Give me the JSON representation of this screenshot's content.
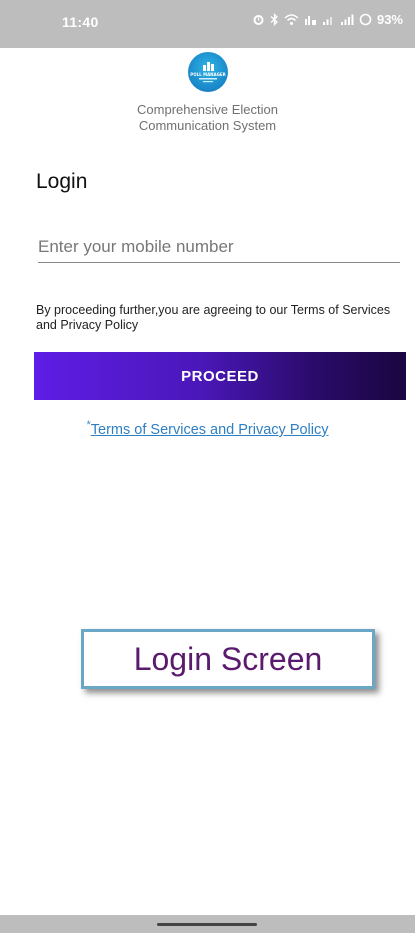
{
  "status_bar": {
    "time": "11:40",
    "battery": "93%",
    "icons": [
      "alarm-icon",
      "bluetooth-icon",
      "wifi-icon",
      "network-type-icon",
      "signal-icon-1",
      "signal-icon-2",
      "battery-icon"
    ]
  },
  "logo": {
    "line1": "POLL MANAGER"
  },
  "app": {
    "tagline_line1": "Comprehensive Election",
    "tagline_line2": "Communication System"
  },
  "login": {
    "title": "Login",
    "mobile_placeholder": "Enter your mobile number",
    "mobile_value": "",
    "agreement": "By proceeding further,you are agreeing to our Terms of Services and Privacy Policy",
    "proceed_label": "PROCEED",
    "terms_star": "*",
    "terms_link": "Terms of Services and Privacy Policy"
  },
  "caption": {
    "text": "Login Screen"
  },
  "colors": {
    "status_bar": "#bdbdbd",
    "button_start": "#5f1de6",
    "button_end": "#1a0640",
    "link": "#2e7fc2",
    "caption_text": "#5a1a6e",
    "caption_border": "#6aa6c6"
  }
}
